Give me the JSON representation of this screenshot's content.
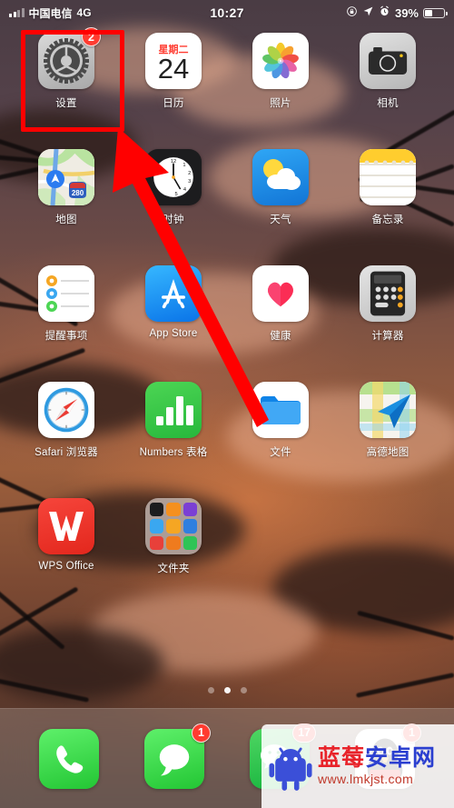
{
  "status_bar": {
    "carrier": "中国电信",
    "network": "4G",
    "time": "10:27",
    "battery_percent": "39%",
    "icons": [
      "signal-bars-icon",
      "rotation-lock-icon",
      "location-arrow-icon",
      "alarm-clock-icon",
      "battery-icon"
    ]
  },
  "home_screen": {
    "apps": [
      {
        "label": "设置",
        "icon": "settings-gear-icon",
        "badge": "2"
      },
      {
        "label": "日历",
        "icon": "calendar-icon",
        "badge": "",
        "weekday": "星期二",
        "day": "24"
      },
      {
        "label": "照片",
        "icon": "photos-icon",
        "badge": ""
      },
      {
        "label": "相机",
        "icon": "camera-icon",
        "badge": ""
      },
      {
        "label": "地图",
        "icon": "maps-icon",
        "badge": "",
        "route_shield": "280"
      },
      {
        "label": "时钟",
        "icon": "clock-icon",
        "badge": ""
      },
      {
        "label": "天气",
        "icon": "weather-icon",
        "badge": ""
      },
      {
        "label": "备忘录",
        "icon": "notes-icon",
        "badge": ""
      },
      {
        "label": "提醒事项",
        "icon": "reminders-icon",
        "badge": ""
      },
      {
        "label": "App Store",
        "icon": "app-store-icon",
        "badge": ""
      },
      {
        "label": "健康",
        "icon": "health-heart-icon",
        "badge": ""
      },
      {
        "label": "计算器",
        "icon": "calculator-icon",
        "badge": ""
      },
      {
        "label": "Safari 浏览器",
        "icon": "safari-compass-icon",
        "badge": ""
      },
      {
        "label": "Numbers 表格",
        "icon": "numbers-chart-icon",
        "badge": ""
      },
      {
        "label": "文件",
        "icon": "files-folder-icon",
        "badge": ""
      },
      {
        "label": "高德地图",
        "icon": "amap-paperplane-icon",
        "badge": ""
      },
      {
        "label": "WPS Office",
        "icon": "wps-office-icon",
        "badge": ""
      },
      {
        "label": "文件夹",
        "icon": "app-folder-icon",
        "badge": ""
      }
    ],
    "folder_mini_colors": [
      "#1c1c1e",
      "#f5901f",
      "#7b3fd4",
      "#3aa7f0",
      "#f5a623",
      "#2f7fe0",
      "#e8403a",
      "#ef7b1e",
      "#2ec456"
    ],
    "page_dots": {
      "count": 3,
      "active_index": 1
    }
  },
  "dock": {
    "apps": [
      {
        "label": "电话",
        "icon": "phone-handset-icon",
        "badge": ""
      },
      {
        "label": "信息",
        "icon": "messages-bubble-icon",
        "badge": "1"
      },
      {
        "label": "微信",
        "icon": "wechat-icon",
        "badge": "17"
      },
      {
        "label": "QQ",
        "icon": "qq-penguin-icon",
        "badge": "1"
      }
    ]
  },
  "annotations": {
    "highlight_target": "设置",
    "arrow_from": "文件",
    "arrow_to": "设置",
    "color": "#ff0000"
  },
  "watermark": {
    "site_name_part1": "蓝莓",
    "site_name_part2": "安卓网",
    "url": "www.lmkjst.com",
    "logo": "android-robot-icon"
  }
}
